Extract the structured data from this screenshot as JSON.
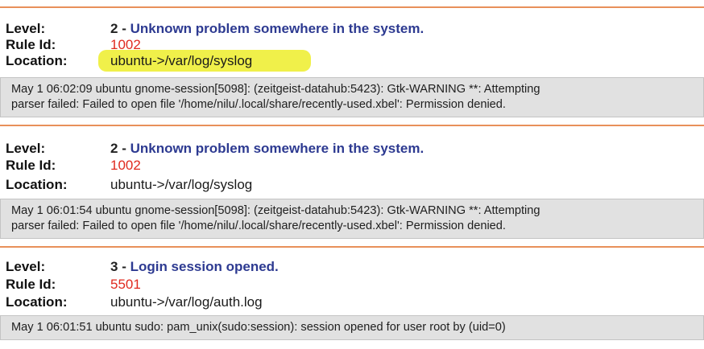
{
  "colors": {
    "separator": "#e8905a",
    "log_background": "#e1e1e1",
    "highlight": "#eded2a",
    "level_description": "#2d3a91",
    "rule_id": "#e02a1f"
  },
  "alerts": [
    {
      "level_label": "Level:",
      "level_number": "2",
      "level_separator": " - ",
      "level_description": "Unknown problem somewhere in the system.",
      "rule_label": "Rule Id:",
      "rule_id": "1002",
      "location_label": "Location:",
      "location": "ubuntu->/var/log/syslog",
      "location_highlighted": true,
      "log_lines": [
        "May 1 06:02:09 ubuntu gnome-session[5098]: (zeitgeist-datahub:5423): Gtk-WARNING **: Attempting",
        "parser failed: Failed to open file '/home/nilu/.local/share/recently-used.xbel': Permission denied."
      ]
    },
    {
      "level_label": "Level:",
      "level_number": "2",
      "level_separator": " - ",
      "level_description": "Unknown problem somewhere in the system.",
      "rule_label": "Rule Id:",
      "rule_id": "1002",
      "location_label": "Location:",
      "location": "ubuntu->/var/log/syslog",
      "location_highlighted": false,
      "log_lines": [
        "May 1 06:01:54 ubuntu gnome-session[5098]: (zeitgeist-datahub:5423): Gtk-WARNING **: Attempting",
        "parser failed: Failed to open file '/home/nilu/.local/share/recently-used.xbel': Permission denied."
      ]
    },
    {
      "level_label": "Level:",
      "level_number": "3",
      "level_separator": " - ",
      "level_description": "Login session opened.",
      "rule_label": "Rule Id:",
      "rule_id": "5501",
      "location_label": "Location:",
      "location": "ubuntu->/var/log/auth.log",
      "location_highlighted": false,
      "log_lines": [
        "May 1 06:01:51 ubuntu sudo: pam_unix(sudo:session): session opened for user root by (uid=0)"
      ]
    }
  ]
}
